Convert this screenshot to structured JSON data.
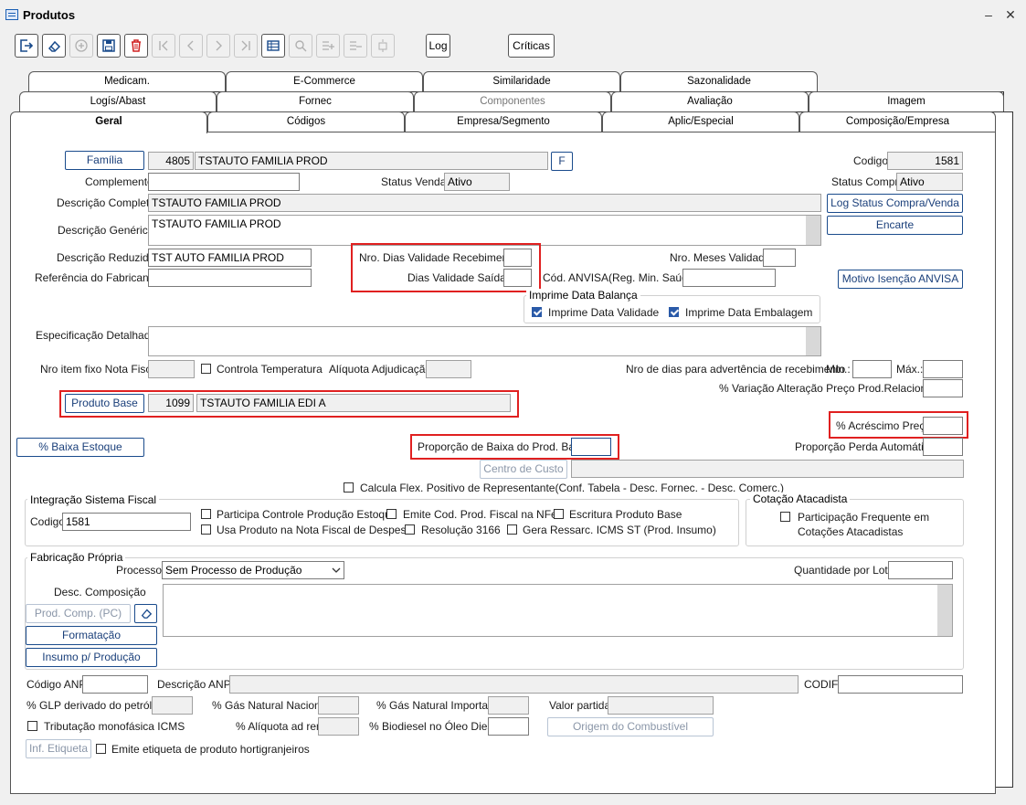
{
  "window": {
    "title": "Produtos",
    "minimize": "–",
    "close": "✕"
  },
  "toolbar": {
    "log": "Log",
    "criticas": "Críticas"
  },
  "tabs": {
    "row1": [
      "Medicam.",
      "E-Commerce",
      "Similaridade",
      "Sazonalidade"
    ],
    "row2": [
      "Logís/Abast",
      "Fornec",
      "Componentes",
      "Avaliação",
      "Imagem"
    ],
    "row3": [
      "Geral",
      "Códigos",
      "Empresa/Segmento",
      "Aplic/Especial",
      "Composição/Empresa"
    ]
  },
  "form": {
    "familia_btn": "Família",
    "familia_code": "4805",
    "familia_desc": "TSTAUTO FAMILIA PROD",
    "f_btn": "F",
    "codigo_lbl": "Codigo",
    "codigo_val": "1581",
    "complemento_lbl": "Complemento",
    "complemento_val": "",
    "status_venda_lbl": "Status Venda",
    "status_venda_val": "Ativo",
    "status_compra_lbl": "Status Compra",
    "status_compra_val": "Ativo",
    "desc_completa_lbl": "Descrição Completa",
    "desc_completa_val": "TSTAUTO FAMILIA PROD",
    "log_status_btn": "Log Status Compra/Venda",
    "desc_generica_lbl": "Descrição Genérica",
    "desc_generica_val": "TSTAUTO FAMILIA PROD",
    "encarte_btn": "Encarte",
    "desc_reduzida_lbl": "Descrição Reduzida",
    "desc_reduzida_val": "TST AUTO FAMILIA PROD",
    "nro_dias_receb_lbl": "Nro. Dias Validade Recebimento",
    "nro_meses_lbl": "Nro. Meses Validade",
    "ref_fabricante_lbl": "Referência do Fabricante",
    "dias_saidas_lbl": "Dias Validade Saídas",
    "cod_anvisa_lbl": "Cód. ANVISA(Reg. Min. Saúde)",
    "motivo_anvisa_btn": "Motivo Isenção ANVISA",
    "imprime_grp": "Imprime Data Balança",
    "imprime_validade": "Imprime Data Validade",
    "imprime_embalagem": "Imprime Data Embalagem",
    "espec_lbl": "Especificação Detalhada",
    "nro_item_lbl": "Nro item fixo Nota Fiscal",
    "controla_temp": "Controla Temperatura",
    "aliquota_adj_lbl": "Alíquota Adjudicação",
    "nro_dias_adv_lbl": "Nro de dias para advertência de recebimento",
    "min_lbl": "Mín.:",
    "max_lbl": "Máx.:",
    "variacao_lbl": "% Variação Alteração Preço Prod.Relacionado",
    "produto_base_btn": "Produto Base",
    "produto_base_code": "1099",
    "produto_base_desc": "TSTAUTO FAMILIA EDI A",
    "acrescimo_lbl": "% Acréscimo Preço",
    "baixa_estoque_btn": "% Baixa Estoque",
    "proporcao_lbl": "Proporção de Baixa do Prod. Base",
    "perda_lbl": "Proporção Perda Automática",
    "centro_custo_btn": "Centro de Custo",
    "calcula_flex": "Calcula Flex. Positivo de Representante(Conf. Tabela - Desc. Fornec. - Desc. Comerc.)",
    "fiscal_grp": "Integração Sistema Fiscal",
    "fiscal_codigo_lbl": "Codigo",
    "fiscal_codigo_val": "1581",
    "participa_ctrl": "Participa Controle Produção Estoque",
    "emite_cod": "Emite Cod. Prod. Fiscal na NFe",
    "escritura": "Escritura Produto Base",
    "usa_produto": "Usa Produto na Nota Fiscal de Despesa",
    "resolucao": "Resolução 3166",
    "gera_ressarc": "Gera Ressarc. ICMS ST (Prod. Insumo)",
    "cotacao_grp": "Cotação Atacadista",
    "participacao_freq": "Participação Frequente em",
    "cotacoes_atac": "Cotações Atacadistas",
    "fabricacao_grp": "Fabricação Própria",
    "processo_lbl": "Processo",
    "processo_val": "Sem Processo de Produção",
    "qtd_lote_lbl": "Quantidade por Lote",
    "desc_comp_lbl": "Desc. Composição",
    "prod_comp_btn": "Prod. Comp. (PC)",
    "formatacao_btn": "Formatação",
    "insumo_btn": "Insumo p/ Produção",
    "cod_anp_lbl": "Código ANP",
    "desc_anp_lbl": "Descrição ANP",
    "codif_lbl": "CODIF",
    "glp_lbl": "% GLP derivado do petróleo",
    "gas_nac_lbl": "% Gás Natural Nacional",
    "gas_imp_lbl": "% Gás Natural Importado",
    "valor_partida_lbl": "Valor partida",
    "tributacao": "Tributação monofásica ICMS",
    "aliq_adrem_lbl": "% Alíquota ad rem",
    "biodiesel_lbl": "% Biodiesel no Óleo Diesel",
    "origem_btn": "Origem do Combustível",
    "inf_etiqueta_btn": "Inf. Etiqueta",
    "emite_etiqueta": "Emite etiqueta de produto hortigranjeiros"
  }
}
